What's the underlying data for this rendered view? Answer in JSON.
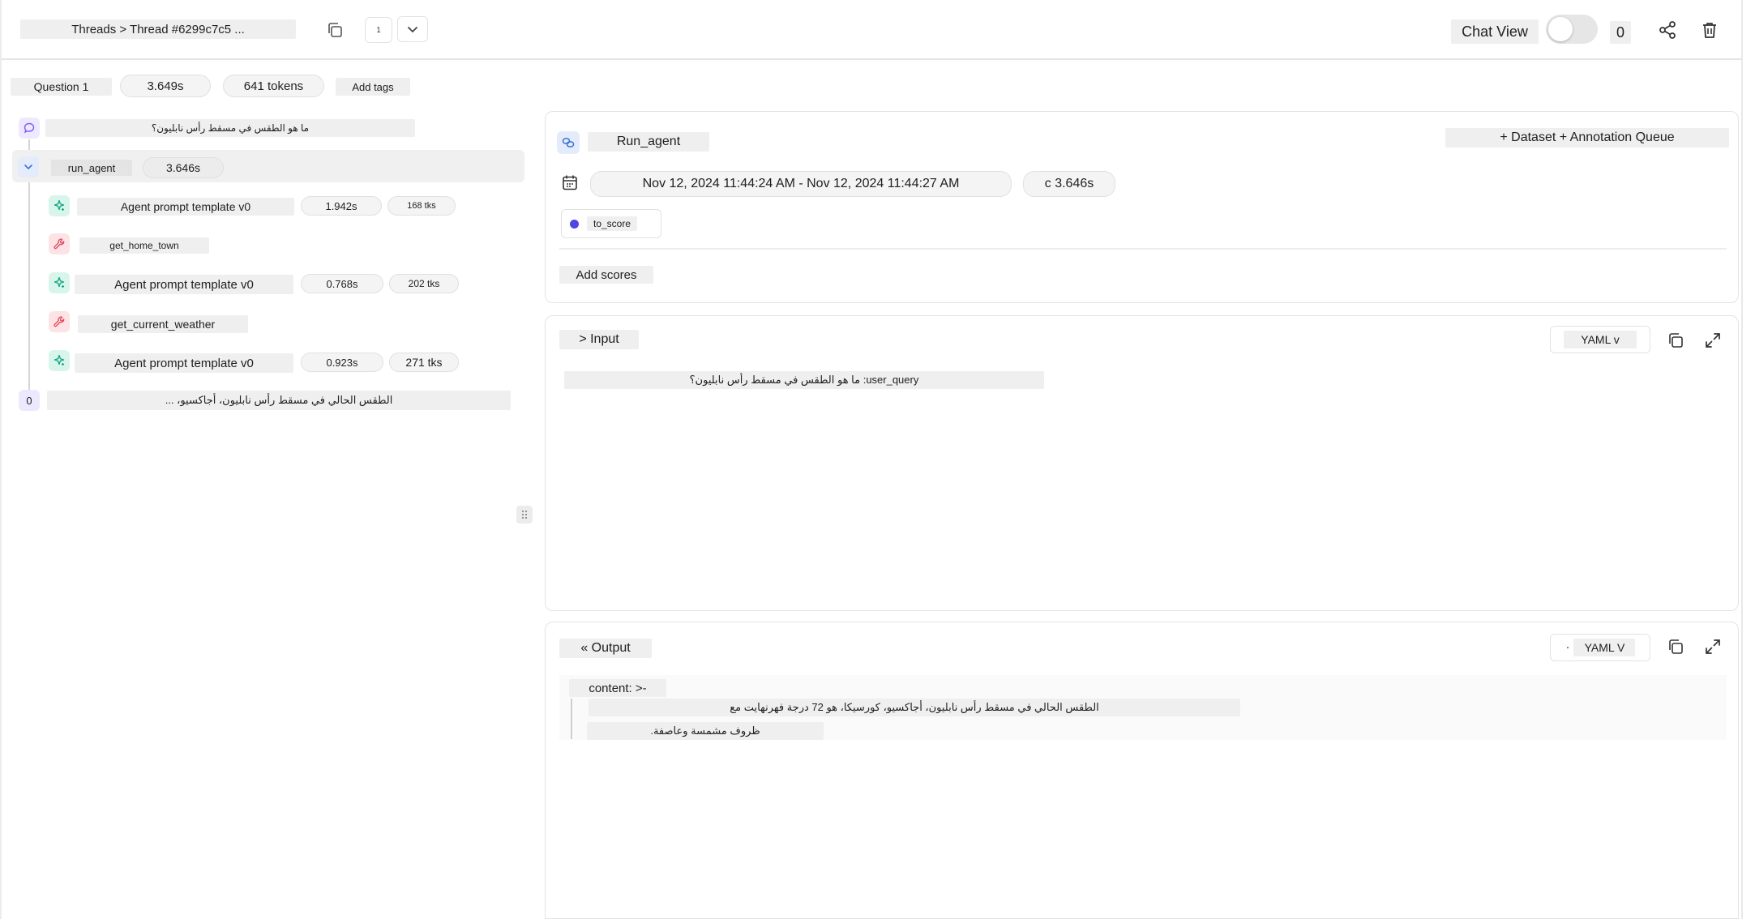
{
  "header": {
    "breadcrumb": "Threads > Thread #6299c7c5 ...",
    "page_counter": "1",
    "chat_view_label": "Chat View",
    "count": "0"
  },
  "summary": {
    "question_label": "Question 1",
    "latency": "3.649s",
    "tokens": "641 tokens",
    "add_tags": "Add tags"
  },
  "tree": {
    "human_message": "ما هو الطقس في مسقط رأس نابليون؟",
    "root": {
      "label": "run_agent",
      "latency": "3.646s"
    },
    "children": [
      {
        "icon": "sparkle-icon",
        "label": "Agent prompt template v0",
        "latency": "1.942s",
        "tokens": "168 tks"
      },
      {
        "icon": "wrench-icon",
        "label": "get_home_town"
      },
      {
        "icon": "sparkle-icon",
        "label": "Agent prompt template v0",
        "latency": "0.768s",
        "tokens": "202 tks"
      },
      {
        "icon": "wrench-icon",
        "label": "get_current_weather"
      },
      {
        "icon": "sparkle-icon",
        "label": "Agent prompt template v0",
        "latency": "0.923s",
        "tokens": "271 tks"
      }
    ],
    "ai_badge": "0",
    "ai_message": "الطقس الحالي في مسقط رأس نابليون، أجاكسيو، ..."
  },
  "run": {
    "name": "Run_agent",
    "dataset_button": "+ Dataset + Annotation Queue",
    "time_range": "Nov 12, 2024 11:44:24 AM - Nov 12, 2024 11:44:27 AM",
    "duration": "c 3.646s",
    "tag": "to_score",
    "add_scores": "Add scores"
  },
  "input": {
    "label": "> Input",
    "format": "YAML v",
    "query": "user_query: ما هو الطقس في مسقط رأس نابليون؟"
  },
  "output": {
    "label": "« Output",
    "format_prefix": "٠",
    "format": "YAML V",
    "content_key": "content: >-",
    "line1": "الطقس الحالي في مسقط رأس نابليون، أجاكسيو، كورسيكا، هو 72 درجة فهرنهايت مع",
    "line2": "ظروف مشمسة وعاصفة."
  },
  "colors": {
    "accent_purple": "#7c5cff",
    "sparkle_bg": "#d8f5ec",
    "sparkle_fg": "#14a37f",
    "wrench_bg": "#fde3e6",
    "wrench_fg": "#e0485a",
    "tag_dot": "#4f46e5"
  }
}
